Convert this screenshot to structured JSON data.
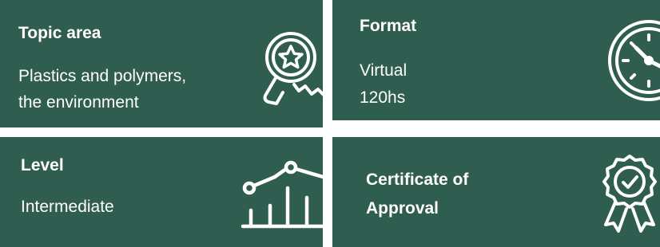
{
  "cards": {
    "topic": {
      "title": "Topic area",
      "line1": "Plastics and polymers,",
      "line2": "the environment",
      "icon": "award-star-icon"
    },
    "format": {
      "title": "Format",
      "line1": "Virtual",
      "line2": "120hs",
      "icon": "clock-icon"
    },
    "level": {
      "title": "Level",
      "line1": "Intermediate",
      "icon": "line-bar-chart-icon"
    },
    "certificate": {
      "title_line1": "Certificate of",
      "title_line2": "Approval",
      "icon": "badge-check-icon"
    }
  },
  "colors": {
    "card_background": "#2f5d4f",
    "text": "#ffffff",
    "page_background": "#ffffff"
  }
}
